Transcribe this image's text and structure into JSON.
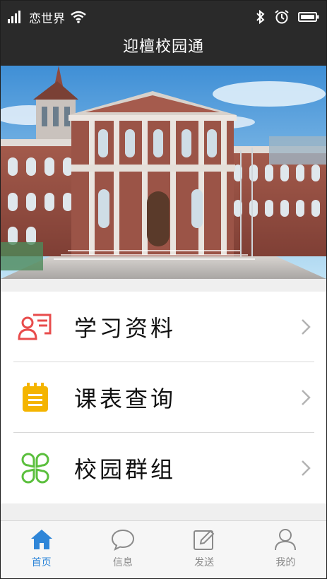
{
  "status": {
    "carrier": "恋世界"
  },
  "app": {
    "title": "迎檀校园通"
  },
  "menu": [
    {
      "label": "学习资料",
      "icon": "study-materials-icon",
      "color": "#e84c4c"
    },
    {
      "label": "课表查询",
      "icon": "schedule-icon",
      "color": "#f4b400"
    },
    {
      "label": "校园群组",
      "icon": "campus-groups-icon",
      "color": "#5bbf3d"
    }
  ],
  "tabs": [
    {
      "label": "首页",
      "icon": "home-icon",
      "active": true
    },
    {
      "label": "信息",
      "icon": "message-icon",
      "active": false
    },
    {
      "label": "发送",
      "icon": "compose-icon",
      "active": false
    },
    {
      "label": "我的",
      "icon": "user-icon",
      "active": false
    }
  ],
  "colors": {
    "accent": "#2f86d8",
    "bar": "#2a2a2a"
  }
}
